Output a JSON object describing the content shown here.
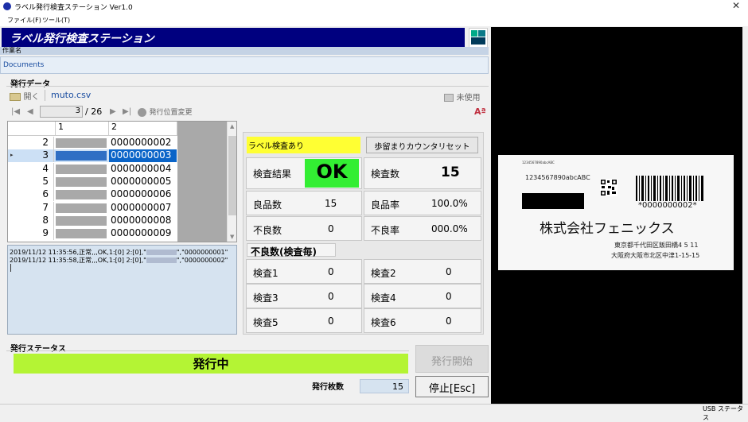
{
  "window": {
    "title": "ラベル発行検査ステーション Ver1.0",
    "close_glyph": "✕"
  },
  "menu": [
    "ファイル(F)",
    "ツール(T)"
  ],
  "header": {
    "title": "ラベル発行検査ステーション"
  },
  "job": {
    "label": "作業名",
    "value": "Documents"
  },
  "issue_data": {
    "section_label": "発行データ",
    "open_label": "開く",
    "file_name": "muto.csv",
    "unused_label": "未使用",
    "font_icon_text": "Aª",
    "page_current": "3",
    "page_total": "/ 26",
    "change_position_label": "発行位置変更",
    "nav": {
      "first": "|◀",
      "prev": "◀",
      "next": "▶",
      "last": "▶|"
    },
    "grid": {
      "col1": "1",
      "col2": "2",
      "rows": [
        {
          "num": "2",
          "code": "0000000002"
        },
        {
          "num": "3",
          "code": "0000000003"
        },
        {
          "num": "4",
          "code": "0000000004"
        },
        {
          "num": "5",
          "code": "0000000005"
        },
        {
          "num": "6",
          "code": "0000000006"
        },
        {
          "num": "7",
          "code": "0000000007"
        },
        {
          "num": "8",
          "code": "0000000008"
        },
        {
          "num": "9",
          "code": "0000000009"
        }
      ]
    }
  },
  "log": {
    "lines": [
      {
        "prefix": "2019/11/12 11:35:56,正常,,,OK,1:[0] 2:[0],\"",
        "suffix": "\",\"0000000001\""
      },
      {
        "prefix": "2019/11/12 11:35:58,正常,,,OK,1:[0] 2:[0],\"",
        "suffix": "\",\"0000000002\""
      }
    ]
  },
  "inspection": {
    "label_flag": "ラベル検査あり",
    "reset_button": "歩留まりカウンタリセット",
    "result_label": "検査結果",
    "result_value": "OK",
    "count_label": "検査数",
    "count_value": "15",
    "good_label": "良品数",
    "good_value": "15",
    "good_rate_label": "良品率",
    "good_rate_value": "100.0%",
    "bad_label": "不良数",
    "bad_value": "0",
    "bad_rate_label": "不良率",
    "bad_rate_value": "000.0%",
    "defect_title": "不良数(検査毎)",
    "checks": [
      {
        "label": "検査1",
        "value": "0"
      },
      {
        "label": "検査2",
        "value": "0"
      },
      {
        "label": "検査3",
        "value": "0"
      },
      {
        "label": "検査4",
        "value": "0"
      },
      {
        "label": "検査5",
        "value": "0"
      },
      {
        "label": "検査6",
        "value": "0"
      }
    ]
  },
  "status": {
    "section_label": "発行ステータス",
    "state": "発行中",
    "start_button": "発行開始",
    "stop_button": "停止[Esc]",
    "count_label": "発行枚数",
    "count_value": "15"
  },
  "camera_label": {
    "small_text": "1234567890abcABC",
    "code_text": "1234567890abcABC",
    "barcode_text": "*0000000002*",
    "company": "株式会社フェニックス",
    "address1": "東京都千代田区飯田橋4 5 11",
    "address2": "大阪府大阪市北区中津1-15-15"
  },
  "footer": {
    "usb_status": "USB ステータス"
  },
  "colors": {
    "header_bg": "#00007f",
    "ok_green": "#33ee33",
    "status_green": "#b4f434",
    "flag_yellow": "#ffff33",
    "selected_row": "#cce0f5",
    "selected_cell": "#0a64c8"
  }
}
